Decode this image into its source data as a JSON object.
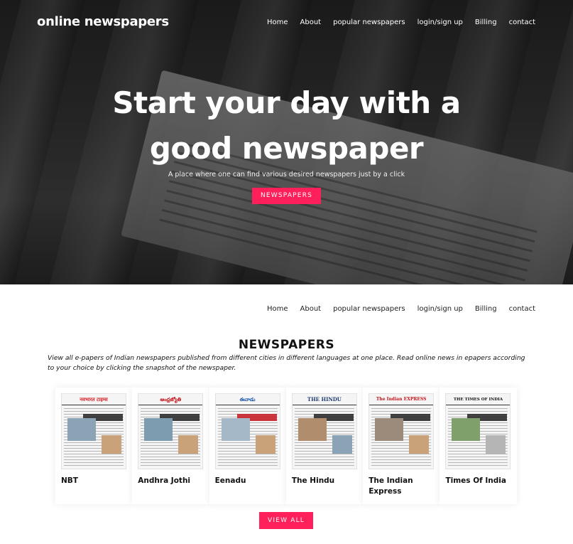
{
  "header": {
    "brand": "online newspapers",
    "nav": [
      "Home",
      "About",
      "popular newspapers",
      "login/sign up",
      "Billing",
      "contact"
    ]
  },
  "hero": {
    "headline": "Start your day with a good newspaper",
    "subtitle": "A place where one can find various desired newspapers just by a click",
    "button_label": "NEWSPAPERS"
  },
  "secondary_nav": [
    "Home",
    "About",
    "popular newspapers",
    "login/sign up",
    "Billing",
    "contact"
  ],
  "newspapers_section": {
    "title": "NEWSPAPERS",
    "description": "View all e-papers of Indian newspapers published from different cities in different languages at one place. Read online news in epapers according to your choice by clicking the snapshot of the newspaper.",
    "cards": [
      {
        "name": "NBT",
        "masthead": "नवभारत टाइम्स",
        "accent": "#d8232a"
      },
      {
        "name": "Andhra Jothi",
        "masthead": "ఆంధ్రజ్యోతి",
        "accent": "#c4161c"
      },
      {
        "name": "Eenadu",
        "masthead": "ఈనాడు",
        "accent": "#1a56a6"
      },
      {
        "name": "The Hindu",
        "masthead": "THE HINDU",
        "accent": "#1f3b73"
      },
      {
        "name": "The Indian Express",
        "masthead": "The Indian EXPRESS",
        "accent": "#c4161c"
      },
      {
        "name": "Times Of India",
        "masthead": "THE TIMES OF INDIA",
        "accent": "#111111"
      }
    ],
    "view_all_label": "VIEW ALL"
  },
  "colors": {
    "accent": "#ff1f5a",
    "hero_overlay": "#000000"
  }
}
